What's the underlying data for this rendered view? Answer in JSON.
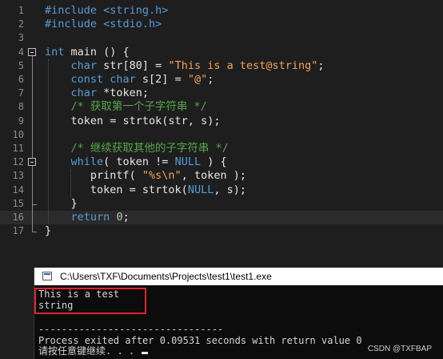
{
  "editor": {
    "line_numbers": [
      "1",
      "2",
      "3",
      "4",
      "5",
      "6",
      "7",
      "8",
      "9",
      "10",
      "11",
      "12",
      "13",
      "14",
      "15",
      "16",
      "17"
    ],
    "lines": [
      [
        {
          "t": "#include <string.h>",
          "c": "pp"
        }
      ],
      [
        {
          "t": "#include <stdio.h>",
          "c": "pp"
        }
      ],
      [],
      [
        {
          "t": "int",
          "c": "kw"
        },
        {
          "t": " main () {",
          "c": ""
        }
      ],
      [
        {
          "t": "    ",
          "c": ""
        },
        {
          "t": "char",
          "c": "kw"
        },
        {
          "t": " str[80] = ",
          "c": ""
        },
        {
          "t": "\"This is a test@string\"",
          "c": "str"
        },
        {
          "t": ";",
          "c": ""
        }
      ],
      [
        {
          "t": "    ",
          "c": ""
        },
        {
          "t": "const char",
          "c": "kw"
        },
        {
          "t": " s[2] = ",
          "c": ""
        },
        {
          "t": "\"@\"",
          "c": "str"
        },
        {
          "t": ";",
          "c": ""
        }
      ],
      [
        {
          "t": "    ",
          "c": ""
        },
        {
          "t": "char",
          "c": "kw"
        },
        {
          "t": " *token;",
          "c": ""
        }
      ],
      [
        {
          "t": "    ",
          "c": ""
        },
        {
          "t": "/* 获取第一个子字符串 */",
          "c": "cm"
        }
      ],
      [
        {
          "t": "    token = strtok(str, s);",
          "c": ""
        }
      ],
      [],
      [
        {
          "t": "    ",
          "c": ""
        },
        {
          "t": "/* 继续获取其他的子字符串 */",
          "c": "cm"
        }
      ],
      [
        {
          "t": "    ",
          "c": ""
        },
        {
          "t": "while",
          "c": "kw"
        },
        {
          "t": "( token != ",
          "c": ""
        },
        {
          "t": "NULL",
          "c": "kw"
        },
        {
          "t": " ) {",
          "c": ""
        }
      ],
      [
        {
          "t": "       printf( ",
          "c": ""
        },
        {
          "t": "\"%s\\n\"",
          "c": "str"
        },
        {
          "t": ", token );",
          "c": ""
        }
      ],
      [
        {
          "t": "       token = strtok(",
          "c": ""
        },
        {
          "t": "NULL",
          "c": "kw"
        },
        {
          "t": ", s);",
          "c": ""
        }
      ],
      [
        {
          "t": "    }",
          "c": ""
        }
      ],
      [
        {
          "t": "    ",
          "c": ""
        },
        {
          "t": "return",
          "c": "kw"
        },
        {
          "t": " ",
          "c": ""
        },
        {
          "t": "0",
          "c": "num"
        },
        {
          "t": ";",
          "c": ""
        }
      ],
      [
        {
          "t": "}",
          "c": ""
        }
      ]
    ],
    "current_line": 16
  },
  "console": {
    "title": "C:\\Users\\TXF\\Documents\\Projects\\test1\\test1.exe",
    "output_lines": [
      "This is a test",
      "string",
      "",
      "--------------------------------",
      "Process exited after 0.09531 seconds with return value 0",
      "请按任意键继续. . . "
    ]
  },
  "watermark": "CSDN @TXFBAP",
  "colors": {
    "keyword": "#569cd6",
    "string": "#f4a35c",
    "comment": "#57a64a",
    "highlight_box": "#e0242b"
  }
}
